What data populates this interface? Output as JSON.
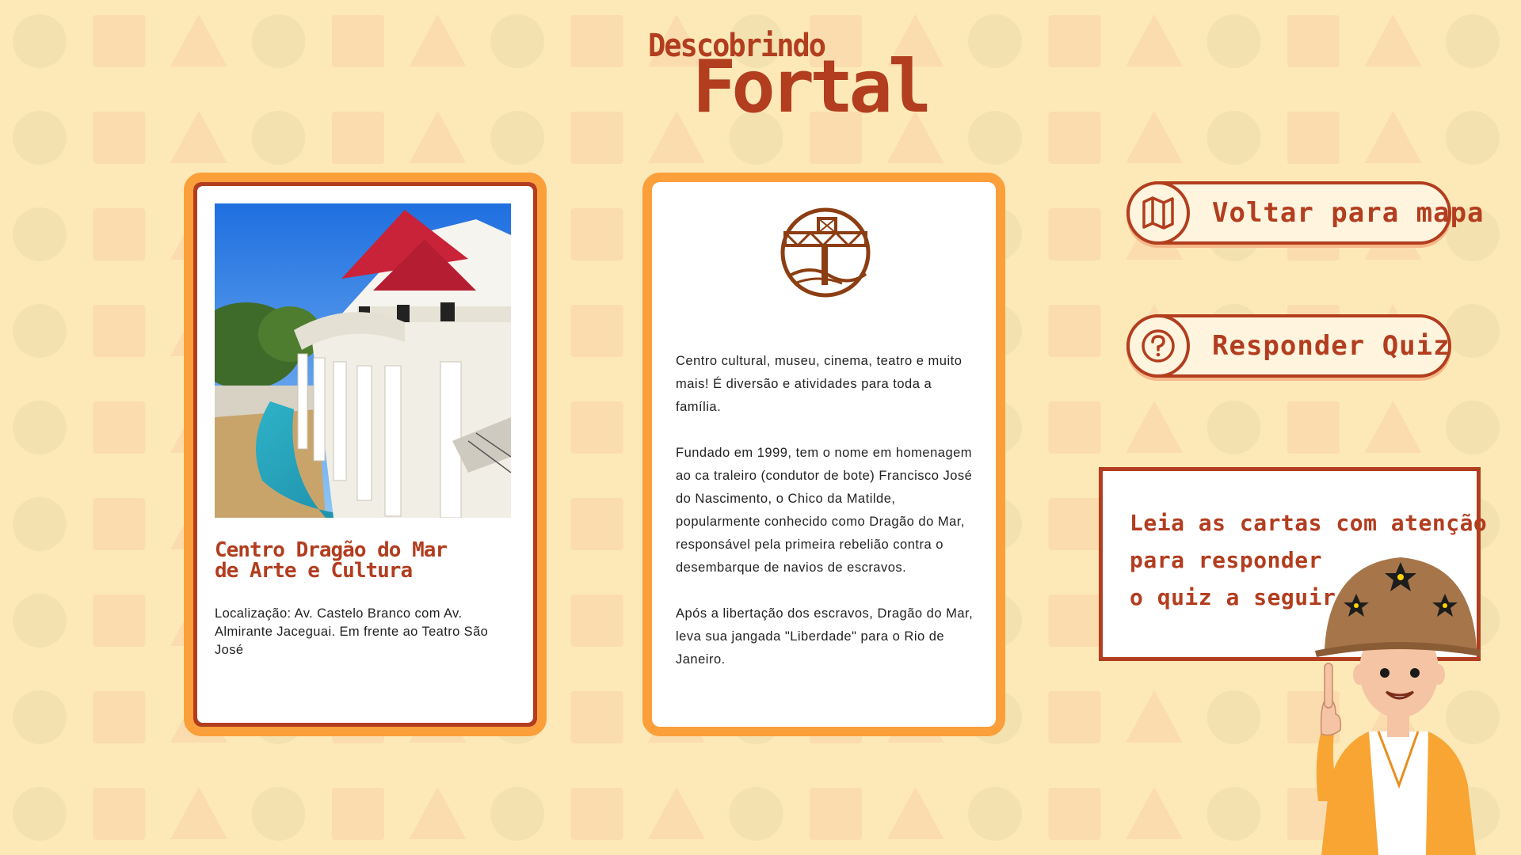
{
  "header": {
    "logo_small": "Descobrindo",
    "logo_big": "Fortal"
  },
  "place_card": {
    "title_line1": "Centro Dragão do Mar",
    "title_line2": "de Arte e Cultura",
    "location": "Localização: Av. Castelo Branco com Av. Almirante Jaceguai. Em frente ao Teatro São José"
  },
  "info_card": {
    "emblem_icon": "bridge-emblem-icon",
    "paragraphs": [
      "Centro cultural, museu, cinema, teatro e muito mais! É diversão e atividades para toda a família.",
      "Fundado em 1999, tem o nome em homenagem ao ca traleiro (condutor de bote) Francisco José do Nascimento, o Chico da Matilde, popularmente conhecido como Dragão do Mar, responsável pela primeira rebelião contra o desembarque de navios de escravos.",
      "Após a libertação dos escravos, Dragão do Mar, leva sua jangada \"Liberdade\" para o Rio de Janeiro."
    ]
  },
  "actions": {
    "map_button": {
      "label": "Voltar para mapa",
      "icon": "map-icon"
    },
    "quiz_button": {
      "label": "Responder Quiz",
      "icon": "question-icon"
    }
  },
  "notice": {
    "line1": "Leia as cartas com atenção",
    "line2": "para responder",
    "line3": "o quiz a seguir."
  },
  "colors": {
    "background": "#fde9b8",
    "accent_red": "#b23d1f",
    "accent_orange": "#fb9f3a"
  }
}
